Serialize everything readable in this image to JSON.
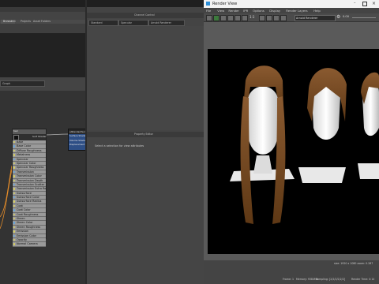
{
  "window": {
    "title": "Render View"
  },
  "left_tabs": {
    "tab1": "Browse",
    "tab2": "List",
    "tab3": "Projects",
    "tab4": "Asset Folders"
  },
  "top_center": {
    "title": "Channel Control"
  },
  "dropdowns": {
    "d1": "Standard",
    "d2": "Specular",
    "d3": "Arnold Renderer"
  },
  "property": {
    "title": "Property Editor",
    "empty_msg": "Select a selection for view attributes"
  },
  "graph": {
    "section": "Graph",
    "node_title": "hair",
    "node_sub": "Surf Shader",
    "node2_title": "aiStandardSurf"
  },
  "node_attrs": [
    "Base",
    "Base Color",
    "Diffuse Roughness",
    "Metalness",
    "Specular",
    "Specular Color",
    "Specular Roughness",
    "Transmission",
    "Transmission Color",
    "Transmission Depth",
    "Transmission Scatter",
    "Transmission Extra Roughness",
    "Subsurface",
    "Subsurface Color",
    "Subsurface Radius",
    "Coat",
    "Coat Color",
    "Coat Roughness",
    "Sheen",
    "Sheen Color",
    "Sheen Roughness",
    "Emission",
    "Emission Color",
    "Opacity",
    "Normal Camera"
  ],
  "node2_attrs": [
    "Surface Shader",
    "Volume Shader",
    "Displacement"
  ],
  "render_menu": [
    "File",
    "View",
    "Render",
    "IPR",
    "Options",
    "Display",
    "Render Layers",
    "Help"
  ],
  "toolbar": {
    "ratio": "1:1",
    "renderer": "Arnold Renderer",
    "value": "0.00"
  },
  "status": {
    "line1": "size: 1920 x 1080 zoom: 0.287",
    "frame": "Frame: 1",
    "memory": "Memory: 9384Mb",
    "sampling": "Sampling: [2/2/2/2/2/2]",
    "render_time": "Render Time: 0:14"
  },
  "colors": {
    "accent": "#d9d94a",
    "hair": "#7a4a22",
    "bg": "#000000"
  }
}
